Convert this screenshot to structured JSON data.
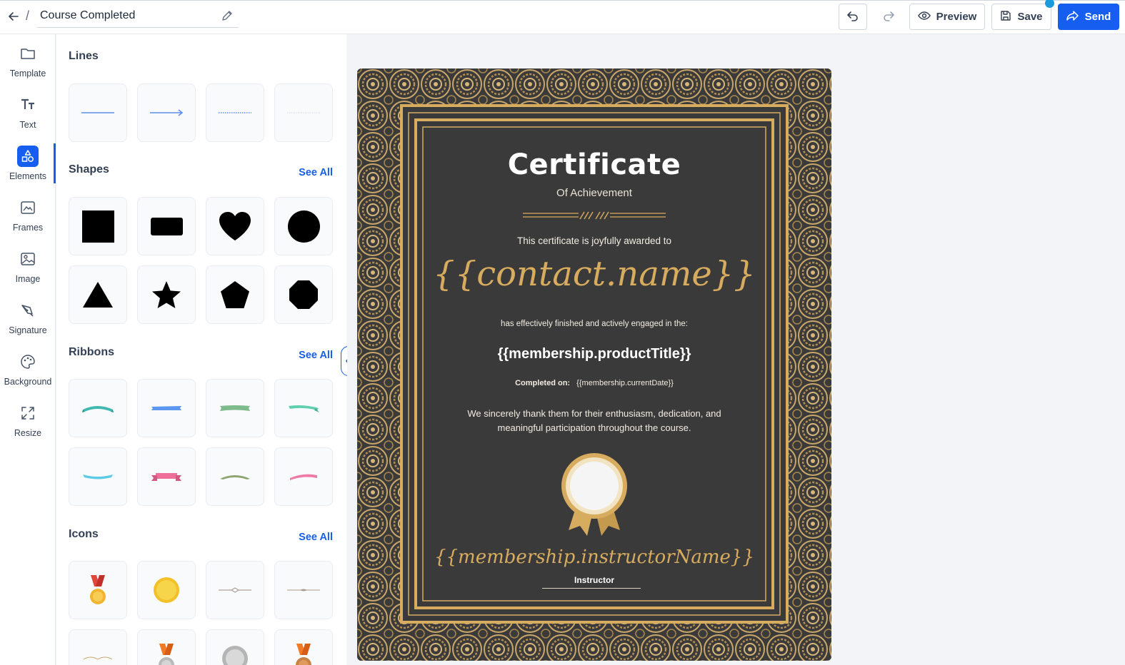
{
  "header": {
    "title": "Course Completed",
    "slash": "/",
    "undo_icon": "undo-icon",
    "redo_icon": "redo-icon",
    "preview_label": "Preview",
    "save_label": "Save",
    "send_label": "Send"
  },
  "rail": {
    "items": [
      {
        "label": "Template",
        "icon": "folder-icon"
      },
      {
        "label": "Text",
        "icon": "text-icon"
      },
      {
        "label": "Elements",
        "icon": "shapes-icon",
        "active": true
      },
      {
        "label": "Frames",
        "icon": "frame-icon"
      },
      {
        "label": "Image",
        "icon": "image-icon"
      },
      {
        "label": "Signature",
        "icon": "pen-icon"
      },
      {
        "label": "Background",
        "icon": "palette-icon"
      },
      {
        "label": "Resize",
        "icon": "resize-icon"
      }
    ]
  },
  "panel": {
    "lines_title": "Lines",
    "shapes_title": "Shapes",
    "ribbons_title": "Ribbons",
    "icons_title": "Icons",
    "see_all": "See All",
    "lines": [
      "solid-line",
      "arrow-line",
      "dotted-line",
      "thin-dotted-line"
    ],
    "shapes": [
      "square",
      "rounded-rectangle",
      "heart",
      "circle",
      "triangle",
      "star",
      "pentagon",
      "octagon"
    ],
    "ribbons": [
      "teal-ribbon",
      "blue-ribbon",
      "green-ribbon",
      "mint-ribbon",
      "cyan-ribbon",
      "pink-ribbon",
      "olive-ribbon",
      "rose-ribbon"
    ],
    "icons": [
      "gold-medal",
      "gold-coin",
      "divider-ornament",
      "thin-ornament",
      "flourish-ornament",
      "orange-medal",
      "silver-coin",
      "bronze-medal"
    ]
  },
  "certificate": {
    "title": "Certificate",
    "subtitle": "Of Achievement",
    "awarded_text": "This certificate is joyfully awarded to",
    "name": "{{contact.name}}",
    "finished_text": "has effectively finished and actively engaged in the:",
    "product": "{{membership.productTitle}}",
    "completed_label": "Completed on:",
    "completed_value": "{{membership.currentDate}}",
    "thanks_line1": "We sincerely thank them for their enthusiasm, dedication, and",
    "thanks_line2": "meaningful participation throughout the course.",
    "instructor_name": "{{membership.instructorName}}",
    "instructor_label": "Instructor",
    "colors": {
      "background": "#3b3a3a",
      "gold": "#d8ac5f"
    }
  },
  "colors": {
    "accent": "#155eef",
    "dot": "#1a9bdc"
  }
}
